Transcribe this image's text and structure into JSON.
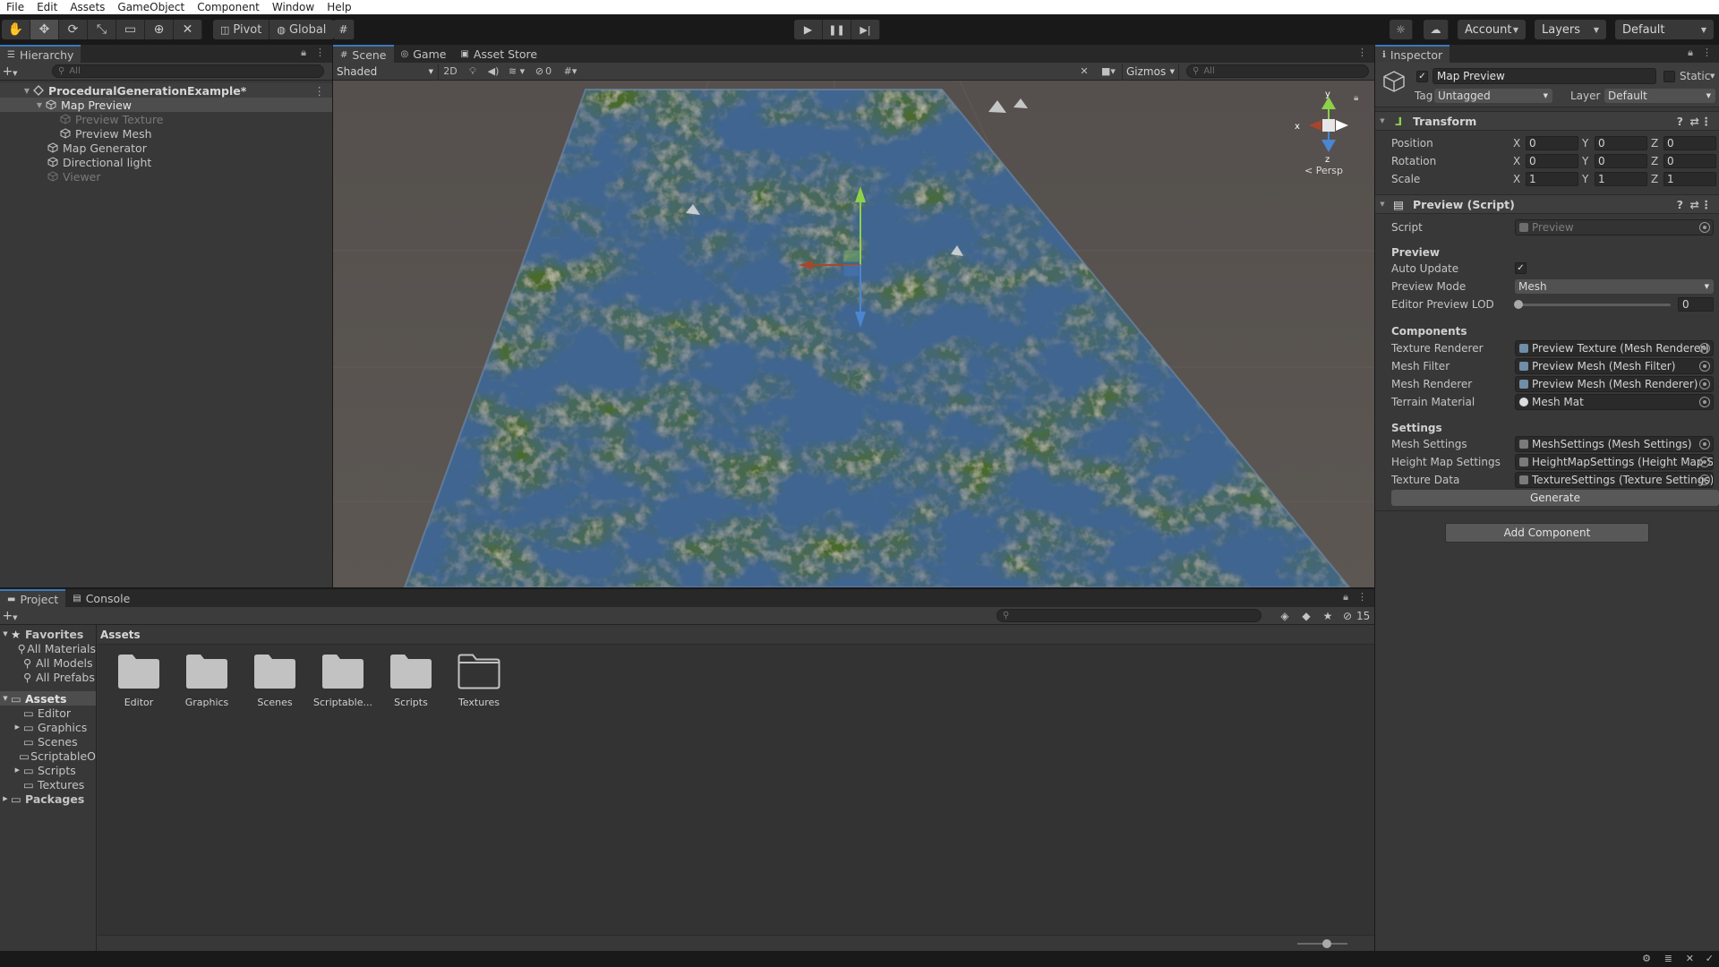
{
  "menu": [
    "File",
    "Edit",
    "Assets",
    "GameObject",
    "Component",
    "Window",
    "Help"
  ],
  "toolbar": {
    "pivot": "Pivot",
    "global": "Global",
    "account": "Account",
    "layers": "Layers",
    "layout": "Default"
  },
  "hierarchy": {
    "tab": "Hierarchy",
    "search_placeholder": "All",
    "scene": "ProceduralGenerationExample*",
    "items": [
      {
        "label": "Map Preview",
        "active": true
      },
      {
        "label": "Preview Texture",
        "active": false
      },
      {
        "label": "Preview Mesh",
        "active": true
      },
      {
        "label": "Map Generator",
        "active": true
      },
      {
        "label": "Directional light",
        "active": true
      },
      {
        "label": "Viewer",
        "active": false
      }
    ]
  },
  "scene": {
    "tabs": [
      "Scene",
      "Game",
      "Asset Store"
    ],
    "shading": "Shaded",
    "mode_2d": "2D",
    "hidden_count": "0",
    "gizmos": "Gizmos",
    "search_placeholder": "All",
    "axis_y": "y",
    "axis_x": "x",
    "axis_z": "z",
    "persp": "< Persp"
  },
  "inspector": {
    "tab": "Inspector",
    "object_name": "Map Preview",
    "static": "Static",
    "tag_label": "Tag",
    "tag": "Untagged",
    "layer_label": "Layer",
    "layer": "Default",
    "transform": {
      "title": "Transform",
      "rows": [
        {
          "label": "Position",
          "x": "0",
          "y": "0",
          "z": "0"
        },
        {
          "label": "Rotation",
          "x": "0",
          "y": "0",
          "z": "0"
        },
        {
          "label": "Scale",
          "x": "1",
          "y": "1",
          "z": "1"
        }
      ]
    },
    "script_component": {
      "title": "Preview (Script)",
      "script_label": "Script",
      "script_value": "Preview",
      "preview_header": "Preview",
      "auto_update_label": "Auto Update",
      "auto_update": true,
      "preview_mode_label": "Preview Mode",
      "preview_mode": "Mesh",
      "lod_label": "Editor Preview LOD",
      "lod_value": "0",
      "components_header": "Components",
      "components": [
        {
          "label": "Texture Renderer",
          "value": "Preview Texture (Mesh Renderer)"
        },
        {
          "label": "Mesh Filter",
          "value": "Preview Mesh (Mesh Filter)"
        },
        {
          "label": "Mesh Renderer",
          "value": "Preview Mesh (Mesh Renderer)"
        },
        {
          "label": "Terrain Material",
          "value": "Mesh Mat"
        }
      ],
      "settings_header": "Settings",
      "settings": [
        {
          "label": "Mesh Settings",
          "value": "MeshSettings (Mesh Settings)"
        },
        {
          "label": "Height Map Settings",
          "value": "HeightMapSettings (Height Map Se"
        },
        {
          "label": "Texture Data",
          "value": "TextureSettings (Texture Settings)"
        }
      ],
      "generate": "Generate"
    },
    "add_component": "Add Component"
  },
  "project": {
    "tabs": [
      "Project",
      "Console"
    ],
    "hidden_count": "15",
    "breadcrumb": "Assets",
    "favorites": "Favorites",
    "favorite_items": [
      "All Materials",
      "All Models",
      "All Prefabs"
    ],
    "assets_root": "Assets",
    "asset_folders": [
      {
        "label": "Editor",
        "expandable": false
      },
      {
        "label": "Graphics",
        "expandable": true
      },
      {
        "label": "Scenes",
        "expandable": false
      },
      {
        "label": "ScriptableO",
        "expandable": false
      },
      {
        "label": "Scripts",
        "expandable": true
      },
      {
        "label": "Textures",
        "expandable": false
      }
    ],
    "packages": "Packages",
    "grid": [
      {
        "label": "Editor",
        "filled": true
      },
      {
        "label": "Graphics",
        "filled": true
      },
      {
        "label": "Scenes",
        "filled": true
      },
      {
        "label": "Scriptable...",
        "filled": true
      },
      {
        "label": "Scripts",
        "filled": true
      },
      {
        "label": "Textures",
        "filled": false
      }
    ]
  },
  "colors": {
    "accent": "#3a79bb",
    "panel": "#383838",
    "water": "#3f6590",
    "grass": "#4a6a2c"
  }
}
